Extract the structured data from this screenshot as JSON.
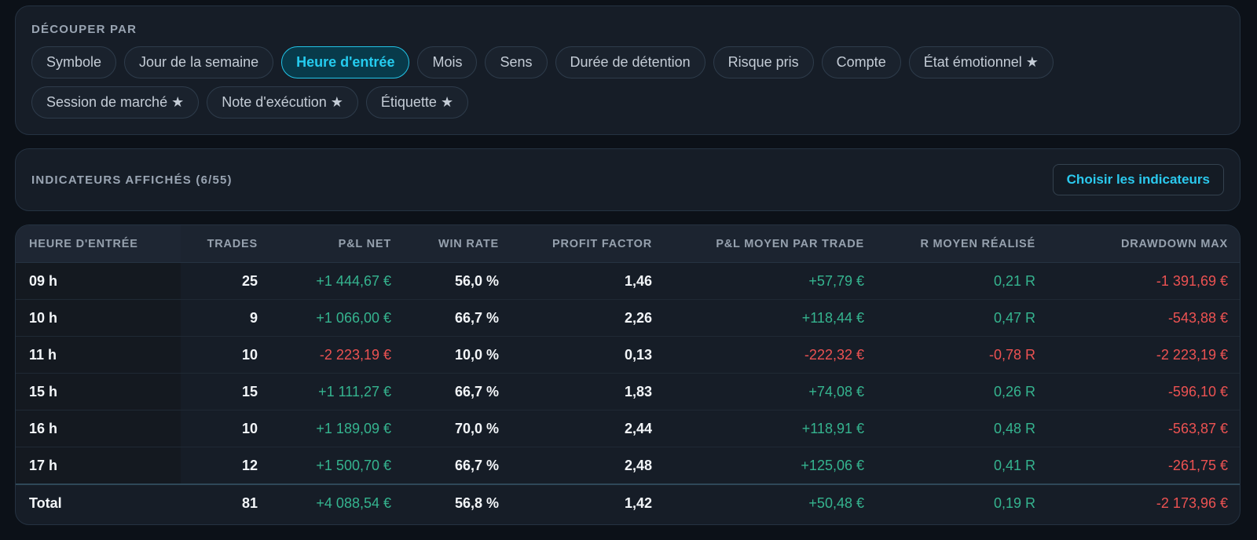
{
  "filters": {
    "title": "DÉCOUPER PAR",
    "chips": [
      {
        "label": "Symbole"
      },
      {
        "label": "Jour de la semaine"
      },
      {
        "label": "Heure d'entrée"
      },
      {
        "label": "Mois"
      },
      {
        "label": "Sens"
      },
      {
        "label": "Durée de détention"
      },
      {
        "label": "Risque pris"
      },
      {
        "label": "Compte"
      },
      {
        "label": "État émotionnel ★"
      },
      {
        "label": "Session de marché ★"
      },
      {
        "label": "Note d'exécution ★"
      },
      {
        "label": "Étiquette ★"
      }
    ],
    "active_chip": "Heure d'entrée"
  },
  "indicators": {
    "title": "INDICATEURS AFFICHÉS (6/55)",
    "choose_label": "Choisir les indicateurs"
  },
  "table": {
    "headers": [
      "HEURE D'ENTRÉE",
      "TRADES",
      "P&L NET",
      "WIN RATE",
      "PROFIT FACTOR",
      "P&L MOYEN PAR TRADE",
      "R MOYEN RÉALISÉ",
      "DRAWDOWN MAX"
    ],
    "rows": [
      {
        "hour": "09 h",
        "trades": "25",
        "pnl": "+1 444,67 €",
        "winrate": "56,0 %",
        "pf": "1,46",
        "avg": "+57,79 €",
        "r": "0,21 R",
        "dd": "-1 391,69 €"
      },
      {
        "hour": "10 h",
        "trades": "9",
        "pnl": "+1 066,00 €",
        "winrate": "66,7 %",
        "pf": "2,26",
        "avg": "+118,44 €",
        "r": "0,47 R",
        "dd": "-543,88 €"
      },
      {
        "hour": "11 h",
        "trades": "10",
        "pnl": "-2 223,19 €",
        "winrate": "10,0 %",
        "pf": "0,13",
        "avg": "-222,32 €",
        "r": "-0,78 R",
        "dd": "-2 223,19 €"
      },
      {
        "hour": "15 h",
        "trades": "15",
        "pnl": "+1 111,27 €",
        "winrate": "66,7 %",
        "pf": "1,83",
        "avg": "+74,08 €",
        "r": "0,26 R",
        "dd": "-596,10 €"
      },
      {
        "hour": "16 h",
        "trades": "10",
        "pnl": "+1 189,09 €",
        "winrate": "70,0 %",
        "pf": "2,44",
        "avg": "+118,91 €",
        "r": "0,48 R",
        "dd": "-563,87 €"
      },
      {
        "hour": "17 h",
        "trades": "12",
        "pnl": "+1 500,70 €",
        "winrate": "66,7 %",
        "pf": "2,48",
        "avg": "+125,06 €",
        "r": "0,41 R",
        "dd": "-261,75 €"
      }
    ],
    "total": {
      "hour": "Total",
      "trades": "81",
      "pnl": "+4 088,54 €",
      "winrate": "56,8 %",
      "pf": "1,42",
      "avg": "+50,48 €",
      "r": "0,19 R",
      "dd": "-2 173,96 €"
    }
  },
  "colors": {
    "accent": "#25ccef",
    "positive": "#35b48f",
    "negative": "#ec5252",
    "background": "#0c1118",
    "panel": "#161d27"
  }
}
